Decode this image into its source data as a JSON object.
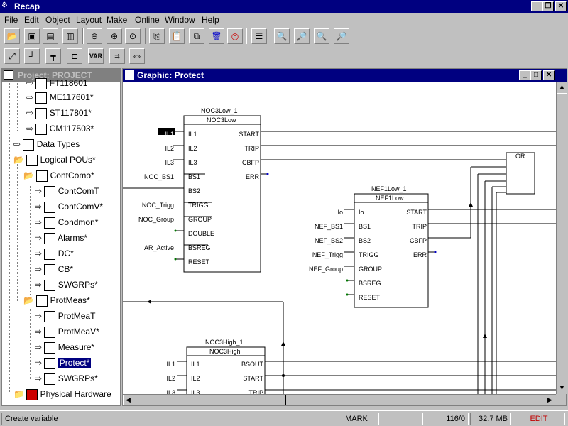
{
  "app": {
    "title": "Recap"
  },
  "menu": [
    "File",
    "Edit",
    "Object",
    "Layout",
    "Make",
    "Online",
    "Window",
    "Help"
  ],
  "project": {
    "title": "Project: PROJECT",
    "items": [
      {
        "label": "FT118601"
      },
      {
        "label": "ME117601*"
      },
      {
        "label": "ST117801*"
      },
      {
        "label": "CM117503*"
      },
      {
        "label": "Data Types"
      },
      {
        "label": "Logical POUs*"
      },
      {
        "label": "ContComo*"
      },
      {
        "label": "ContComT"
      },
      {
        "label": "ContComV*"
      },
      {
        "label": "Condmon*"
      },
      {
        "label": "Alarms*"
      },
      {
        "label": "DC*"
      },
      {
        "label": "CB*"
      },
      {
        "label": "SWGRPs*"
      },
      {
        "label": "ProtMeas*"
      },
      {
        "label": "ProtMeaT"
      },
      {
        "label": "ProtMeaV*"
      },
      {
        "label": "Measure*"
      },
      {
        "label": "Protect*"
      },
      {
        "label": "SWGRPs*"
      },
      {
        "label": "Physical Hardware"
      }
    ]
  },
  "graphic": {
    "title": "Graphic: Protect",
    "block1": {
      "instance": "NOC3Low_1",
      "type": "NOC3Low",
      "inputs": [
        "IL1",
        "IL2",
        "IL3",
        "BS1",
        "BS2",
        "TRIGG",
        "GROUP",
        "DOUBLE",
        "BSREG",
        "RESET"
      ],
      "outputs": [
        "START",
        "TRIP",
        "CBFP",
        "ERR"
      ],
      "ext_inputs": [
        "IL1",
        "IL2",
        "IL3",
        "NOC_BS1",
        "",
        "NOC_Trigg",
        "NOC_Group",
        "",
        "AR_Active",
        ""
      ]
    },
    "block2": {
      "instance": "NEF1Low_1",
      "type": "NEF1Low",
      "inputs": [
        "Io",
        "BS1",
        "BS2",
        "TRIGG",
        "GROUP",
        "BSREG",
        "RESET"
      ],
      "outputs": [
        "START",
        "TRIP",
        "CBFP",
        "ERR"
      ],
      "ext_inputs": [
        "Io",
        "NEF_BS1",
        "NEF_BS2",
        "NEF_Trigg",
        "NEF_Group",
        "",
        ""
      ]
    },
    "block3": {
      "instance": "NOC3High_1",
      "type": "NOC3High",
      "inputs": [
        "IL1",
        "IL2",
        "IL3"
      ],
      "outputs": [
        "BSOUT",
        "START",
        "TRIP"
      ],
      "ext_inputs": [
        "IL1",
        "IL2",
        "IL3"
      ]
    },
    "or_block": {
      "label": "OR"
    }
  },
  "status": {
    "message": "Create variable",
    "mark": "MARK",
    "position": "116/0",
    "memory": "32.7 MB",
    "mode": "EDIT",
    "mode_color": "#c00000"
  }
}
